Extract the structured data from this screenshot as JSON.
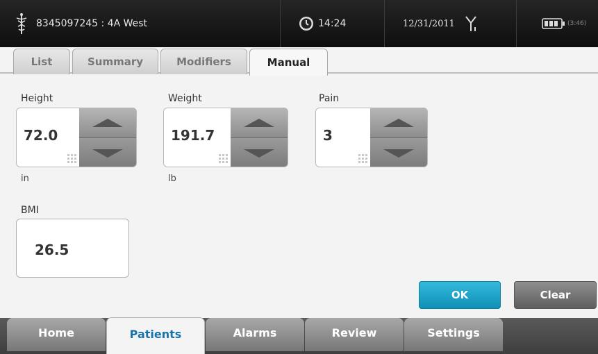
{
  "status_bar": {
    "patient": "8345097245 : 4A West",
    "time": "14:24",
    "date": "12/31/2011",
    "battery_time": "(3:46)"
  },
  "sub_tabs": [
    {
      "label": "List"
    },
    {
      "label": "Summary"
    },
    {
      "label": "Modifiers"
    },
    {
      "label": "Manual",
      "active": true
    }
  ],
  "fields": {
    "height": {
      "label": "Height",
      "value": "72.0",
      "unit": "in"
    },
    "weight": {
      "label": "Weight",
      "value": "191.7",
      "unit": "lb"
    },
    "pain": {
      "label": "Pain",
      "value": "3"
    },
    "bmi": {
      "label": "BMI",
      "value": "26.5"
    }
  },
  "actions": {
    "ok": "OK",
    "clear": "Clear"
  },
  "nav_tabs": [
    {
      "label": "Home"
    },
    {
      "label": "Patients",
      "active": true
    },
    {
      "label": "Alarms"
    },
    {
      "label": "Review"
    },
    {
      "label": "Settings"
    }
  ],
  "colors": {
    "accent": "#1a9fc9",
    "active_nav_text": "#1a73a8"
  }
}
